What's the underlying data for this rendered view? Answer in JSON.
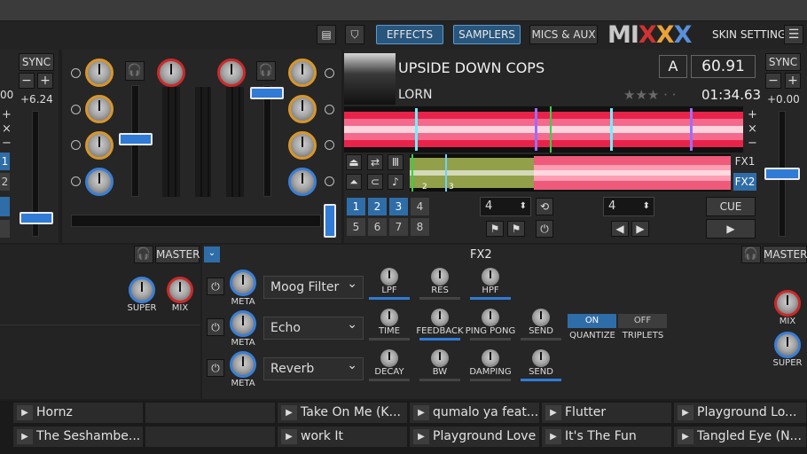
{
  "toolbar": {
    "effects_label": "EFFECTS",
    "samplers_label": "SAMPLERS",
    "mics_label": "MICS & AUX",
    "logo_text": "MIXXX",
    "skin_settings_label": "SKIN SETTINGS"
  },
  "deck1": {
    "sync_label": "SYNC",
    "minus_label": "−",
    "plus_label": "+",
    "rate_label": "+6.24",
    "rate_partial": "00",
    "fx1_label": "1",
    "fx2_label": "2"
  },
  "deck2": {
    "title": "UPSIDE DOWN COPS",
    "artist": "LORN",
    "key": "A",
    "bpm": "60.91",
    "rating": "★★★ · ·",
    "time": "01:34.63",
    "sync_label": "SYNC",
    "minus_label": "−",
    "plus_label": "+",
    "rate_label": "+0.00",
    "fx1_label": "FX1",
    "fx2_label": "FX2",
    "hotcues": [
      "1",
      "2",
      "3",
      "4",
      "5",
      "6",
      "7",
      "8"
    ],
    "loop_size": "4",
    "beatjump_size": "4",
    "cue_label": "CUE",
    "play_label": "▶",
    "marker_2": "2",
    "marker_3": "3"
  },
  "mixer": {
    "headphone_icon": "🎧"
  },
  "fx_panel": {
    "master_label_left": "MASTER",
    "title": "FX2",
    "master_label_right": "MASTER",
    "super_label": "SUPER",
    "mix_label": "MIX",
    "units": [
      {
        "meta_label": "META",
        "effect": "Moog Filter",
        "params": [
          "LPF",
          "RES",
          "HPF"
        ]
      },
      {
        "meta_label": "META",
        "effect": "Echo",
        "params": [
          "TIME",
          "FEEDBACK",
          "PING PONG",
          "SEND"
        ]
      },
      {
        "meta_label": "META",
        "effect": "Reverb",
        "params": [
          "DECAY",
          "BW",
          "DAMPING",
          "SEND"
        ]
      }
    ],
    "quantize_on": "ON",
    "quantize_label": "QUANTIZE",
    "triplets_off": "OFF",
    "triplets_label": "TRIPLETS"
  },
  "library": {
    "row1": [
      "Hornz",
      "",
      "Take On Me (K...",
      "qumalo ya feat...",
      "Flutter",
      "Playground Lo..."
    ],
    "row2": [
      "The Seshambe...",
      "",
      "work It",
      "Playground Love",
      "It's The Fun",
      "Tangled Eye (N..."
    ]
  }
}
